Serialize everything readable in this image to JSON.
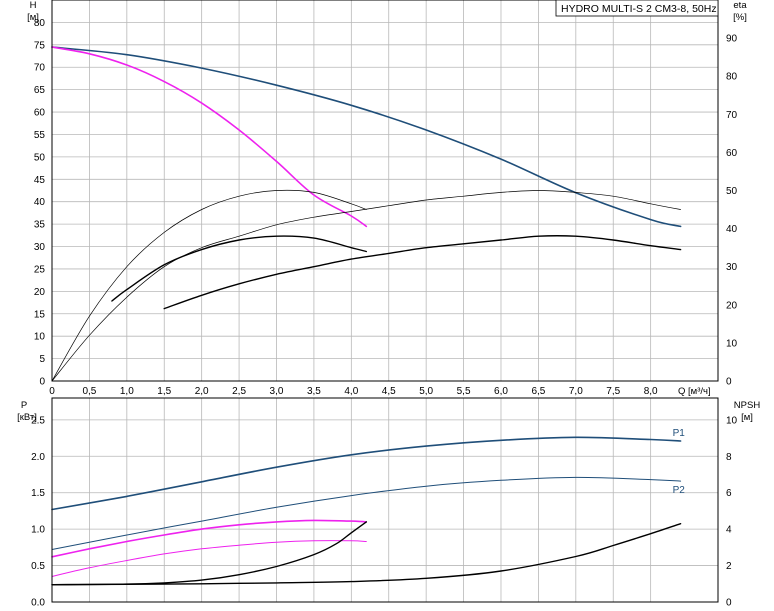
{
  "chart_data": [
    {
      "type": "line",
      "panel": "head-efficiency",
      "title": "HYDRO MULTI-S 2 CM3-8, 50Hz",
      "colors": {
        "blue": "#1f4e79",
        "magenta": "#ee22ee",
        "black": "#000000",
        "grid": "#b8b8b8"
      },
      "x_axis": {
        "label": "Q [м³/ч]",
        "range": [
          0,
          8.9
        ],
        "ticks": [
          0,
          0.5,
          1.0,
          1.5,
          2.0,
          2.5,
          3.0,
          3.5,
          4.0,
          4.5,
          5.0,
          5.5,
          6.0,
          6.5,
          7.0,
          7.5,
          8.0
        ],
        "tick_labels": [
          "0",
          "0,5",
          "1,0",
          "1,5",
          "2,0",
          "2,5",
          "3,0",
          "3,5",
          "4,0",
          "4,5",
          "5,0",
          "5,5",
          "6,0",
          "6,5",
          "7,0",
          "7,5",
          "8,0"
        ]
      },
      "y_left": {
        "label_line1": "H",
        "label_line2": "[м]",
        "range": [
          0,
          85
        ],
        "ticks": [
          0,
          5,
          10,
          15,
          20,
          25,
          30,
          35,
          40,
          45,
          50,
          55,
          60,
          65,
          70,
          75,
          80
        ]
      },
      "y_right": {
        "label_line1": "eta",
        "label_line2": "[%]",
        "range": [
          0,
          100
        ],
        "ticks": [
          0,
          10,
          20,
          30,
          40,
          50,
          60,
          70,
          80,
          90
        ]
      },
      "grid": true,
      "series": [
        {
          "axis": "left",
          "color": "#1f4e79",
          "width": 1.6,
          "x": [
            0,
            1,
            2,
            3,
            4,
            5,
            6,
            7,
            8,
            8.4
          ],
          "y": [
            74.5,
            72.8,
            69.8,
            66.0,
            61.5,
            56.0,
            49.5,
            42.0,
            36.0,
            34.5
          ]
        },
        {
          "axis": "left",
          "color": "#ee22ee",
          "width": 1.6,
          "x": [
            0,
            0.5,
            1.0,
            1.5,
            2.0,
            2.5,
            3.0,
            3.5,
            4.0,
            4.2
          ],
          "y": [
            74.5,
            73.0,
            70.5,
            66.8,
            62.0,
            56.0,
            49.0,
            41.5,
            36.8,
            34.5
          ]
        },
        {
          "axis": "right",
          "color": "#000000",
          "width": 0.7,
          "x": [
            0,
            0.5,
            1.0,
            1.5,
            2.0,
            2.5,
            3.0,
            3.5,
            4.0,
            4.2
          ],
          "y": [
            0,
            17,
            30,
            39,
            45,
            48.5,
            50,
            49.5,
            46.5,
            45
          ]
        },
        {
          "axis": "right",
          "color": "#000000",
          "width": 0.7,
          "x": [
            0,
            0.5,
            1.0,
            1.5,
            2.0,
            2.5,
            3.0,
            3.5,
            4.0,
            4.5,
            5.0,
            5.5,
            6.0,
            6.5,
            7.0,
            7.5,
            8.0,
            8.4
          ],
          "y": [
            0,
            12,
            22,
            30,
            35,
            38,
            41,
            43,
            44.5,
            46,
            47.5,
            48.5,
            49.5,
            50,
            49.5,
            48.5,
            46.5,
            45
          ]
        },
        {
          "axis": "right",
          "color": "#000000",
          "width": 1.4,
          "x": [
            0.8,
            1.0,
            1.5,
            2.0,
            2.5,
            3.0,
            3.5,
            4.0,
            4.2
          ],
          "y": [
            21,
            24,
            30.5,
            34.5,
            37,
            38,
            37.5,
            35,
            34
          ]
        },
        {
          "axis": "right",
          "color": "#000000",
          "width": 1.4,
          "x": [
            1.5,
            2.0,
            2.5,
            3.0,
            3.5,
            4.0,
            4.5,
            5.0,
            5.5,
            6.0,
            6.5,
            7.0,
            7.5,
            8.0,
            8.4
          ],
          "y": [
            19,
            22.5,
            25.5,
            28,
            30,
            32,
            33.5,
            35,
            36,
            37,
            38,
            38,
            37,
            35.5,
            34.5
          ]
        }
      ],
      "series_labels": []
    },
    {
      "type": "line",
      "panel": "power-npsh",
      "x_axis": {
        "range": [
          0,
          8.9
        ]
      },
      "y_left": {
        "label_line1": "P",
        "label_line2": "[кВт]",
        "range": [
          0,
          2.8
        ],
        "ticks": [
          0,
          0.5,
          1.0,
          1.5,
          2.0,
          2.5
        ],
        "tick_labels": [
          "0.0",
          "0.5",
          "1.0",
          "1.5",
          "2.0",
          "2.5"
        ]
      },
      "y_right": {
        "label_line1": "NPSH",
        "label_line2": "[м]",
        "range": [
          0,
          11.2
        ],
        "ticks": [
          0,
          2,
          4,
          6,
          8,
          10
        ]
      },
      "grid": true,
      "series": [
        {
          "name": "P1",
          "axis": "left",
          "color": "#1f4e79",
          "width": 1.6,
          "x": [
            0,
            1,
            2,
            3,
            4,
            5,
            6,
            7,
            8,
            8.4
          ],
          "y": [
            1.27,
            1.45,
            1.65,
            1.85,
            2.02,
            2.14,
            2.22,
            2.26,
            2.23,
            2.21
          ]
        },
        {
          "name": "P2",
          "axis": "left",
          "color": "#1f4e79",
          "width": 1.0,
          "x": [
            0,
            1,
            2,
            3,
            4,
            5,
            6,
            7,
            8,
            8.4
          ],
          "y": [
            0.72,
            0.92,
            1.11,
            1.3,
            1.46,
            1.59,
            1.67,
            1.71,
            1.68,
            1.66
          ]
        },
        {
          "axis": "left",
          "color": "#ee22ee",
          "width": 1.6,
          "x": [
            0,
            0.5,
            1.0,
            1.5,
            2.0,
            2.5,
            3.0,
            3.5,
            4.0,
            4.2
          ],
          "y": [
            0.62,
            0.73,
            0.83,
            0.92,
            1.0,
            1.06,
            1.1,
            1.12,
            1.11,
            1.1
          ]
        },
        {
          "axis": "left",
          "color": "#ee22ee",
          "width": 1.0,
          "x": [
            0,
            0.5,
            1.0,
            1.5,
            2.0,
            2.5,
            3.0,
            3.5,
            4.0,
            4.2
          ],
          "y": [
            0.35,
            0.47,
            0.57,
            0.66,
            0.73,
            0.78,
            0.82,
            0.84,
            0.84,
            0.83
          ]
        },
        {
          "axis": "right",
          "color": "#000000",
          "width": 1.4,
          "x": [
            0,
            1,
            2,
            3,
            4,
            5,
            6,
            7,
            7.5,
            8,
            8.4
          ],
          "y": [
            0.95,
            0.97,
            1.0,
            1.05,
            1.12,
            1.3,
            1.7,
            2.5,
            3.1,
            3.75,
            4.3
          ]
        },
        {
          "axis": "right",
          "color": "#000000",
          "width": 1.4,
          "x": [
            0,
            1.0,
            1.5,
            2.0,
            2.5,
            3.0,
            3.5,
            3.8,
            4.0,
            4.2
          ],
          "y": [
            0.95,
            0.98,
            1.05,
            1.2,
            1.5,
            1.95,
            2.6,
            3.2,
            3.8,
            4.4
          ]
        }
      ],
      "series_labels": [
        {
          "text": "P1",
          "series": 0
        },
        {
          "text": "P2",
          "series": 1
        }
      ]
    }
  ]
}
